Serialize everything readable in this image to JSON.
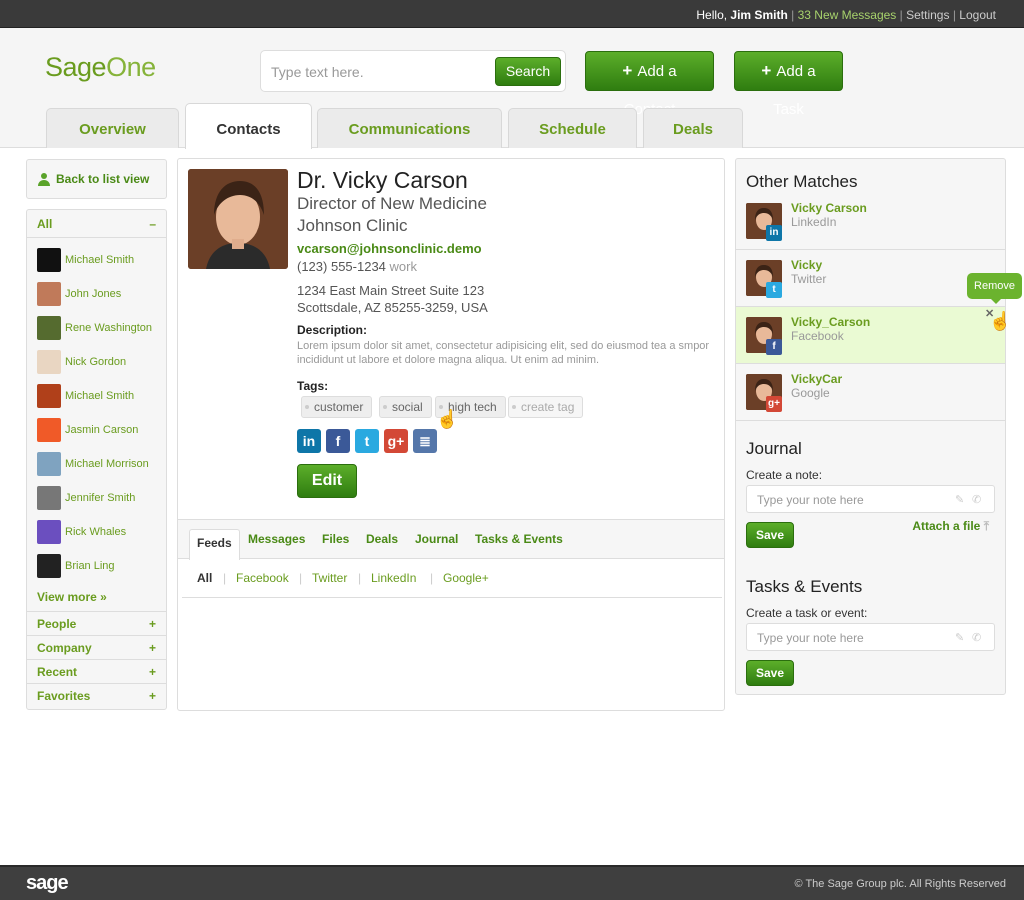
{
  "topbar": {
    "hello": "Hello,",
    "user": "Jim Smith",
    "messages": "33 New Messages",
    "settings": "Settings",
    "logout": "Logout",
    "sep": "|"
  },
  "brand": {
    "name_a": "Sage",
    "name_b": "One"
  },
  "search": {
    "placeholder": "Type text here.",
    "button": "Search"
  },
  "actions": {
    "add_contact": "Add a Contact",
    "add_task": "Add a Task",
    "plus": "+"
  },
  "tabs": [
    "Overview",
    "Contacts",
    "Communications",
    "Schedule",
    "Deals"
  ],
  "sidebar": {
    "back": "Back to list view",
    "all": "All",
    "all_toggle": "–",
    "people": [
      {
        "name": "Michael Smith",
        "bg": "#111111"
      },
      {
        "name": "John Jones",
        "bg": "#c07a5a"
      },
      {
        "name": "Rene Washington",
        "bg": "#556b2f"
      },
      {
        "name": "Nick Gordon",
        "bg": "#e9d6c2"
      },
      {
        "name": "Michael Smith",
        "bg": "#b0401a"
      },
      {
        "name": "Jasmin Carson",
        "bg": "#f05a28"
      },
      {
        "name": "Michael Morrison",
        "bg": "#7fa3c0"
      },
      {
        "name": "Jennifer Smith",
        "bg": "#777777"
      },
      {
        "name": "Rick Whales",
        "bg": "#6b4fbf"
      },
      {
        "name": "Brian Ling",
        "bg": "#222222"
      }
    ],
    "view_more": "View more »",
    "categories": [
      "People",
      "Company",
      "Recent",
      "Favorites"
    ],
    "cat_toggle": "+"
  },
  "contact": {
    "name": "Dr. Vicky Carson",
    "title": "Director of New Medicine",
    "company": "Johnson Clinic",
    "email": "vcarson@johnsonclinic.demo",
    "phone": "(123) 555-1234",
    "phone_label": "work",
    "address1": "1234 East Main Street Suite 123",
    "address2": "Scottsdale, AZ 85255-3259, USA",
    "desc_label": "Description:",
    "description": "Lorem ipsum dolor sit amet, consectetur adipisicing elit, sed do eiusmod tea a smpor incididunt ut labore et dolore magna aliqua. Ut enim ad minim.",
    "tags_label": "Tags:",
    "tags": [
      "customer",
      "social",
      "high tech"
    ],
    "create_tag": "create tag",
    "edit": "Edit",
    "social": [
      {
        "name": "linkedin-icon",
        "glyph": "in",
        "color": "#0e76a8"
      },
      {
        "name": "facebook-icon",
        "glyph": "f",
        "color": "#3b5998"
      },
      {
        "name": "twitter-icon",
        "glyph": "t",
        "color": "#2aa9e0"
      },
      {
        "name": "google-plus-icon",
        "glyph": "g+",
        "color": "#d34836"
      },
      {
        "name": "notes-icon",
        "glyph": "≣",
        "color": "#5577aa"
      }
    ]
  },
  "feeds": {
    "tabs": [
      "Feeds",
      "Messages",
      "Files",
      "Deals",
      "Journal",
      "Tasks & Events"
    ],
    "filters": [
      "All",
      "Facebook",
      "Twitter",
      "LinkedIn",
      "Google+"
    ],
    "sep": "|"
  },
  "right": {
    "other_matches": "Other Matches",
    "matches": [
      {
        "name": "Vicky Carson",
        "source": "LinkedIn",
        "badge": "in",
        "color": "#0e76a8"
      },
      {
        "name": "Vicky",
        "source": "Twitter",
        "badge": "t",
        "color": "#2aa9e0"
      },
      {
        "name": "Vicky_Carson",
        "source": "Facebook",
        "badge": "f",
        "color": "#3b5998"
      },
      {
        "name": "VickyCar",
        "source": "Google",
        "badge": "g+",
        "color": "#d34836"
      }
    ],
    "remove": "Remove",
    "journal": "Journal",
    "create_note": "Create a note:",
    "note_placeholder": "Type your note here",
    "save": "Save",
    "attach": "Attach a file",
    "tasks": "Tasks & Events",
    "create_task": "Create a task or event:",
    "task_placeholder": "Type your note here"
  },
  "footer": {
    "logo": "sage",
    "copyright": "© The Sage Group plc. All Rights Reserved"
  },
  "colors": {
    "accent": "#6a9c1f",
    "button": "#3f9a1b",
    "highlight": "#eafad3"
  }
}
